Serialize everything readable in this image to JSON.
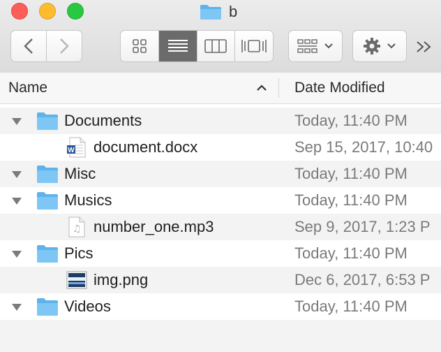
{
  "window": {
    "title": "b",
    "title_icon": "folder-icon"
  },
  "toolbar": {
    "back_icon": "chevron-left-icon",
    "forward_icon": "chevron-right-icon",
    "views": [
      {
        "name": "icon-view-icon",
        "active": false
      },
      {
        "name": "list-view-icon",
        "active": true
      },
      {
        "name": "column-view-icon",
        "active": false
      },
      {
        "name": "cover-flow-view-icon",
        "active": false
      }
    ],
    "arrange_icon": "arrange-grid-icon",
    "action_icon": "gear-icon",
    "more_icon": "double-chevron-right-icon"
  },
  "columns": {
    "name": "Name",
    "date_modified": "Date Modified"
  },
  "rows": [
    {
      "type": "folder",
      "name": "Documents",
      "date": "Today, 11:40 PM",
      "icon": "folder-icon",
      "expanded": true
    },
    {
      "type": "file",
      "name": "document.docx",
      "date": "Sep 15, 2017, 10:40",
      "icon": "word-document-icon"
    },
    {
      "type": "folder",
      "name": "Misc",
      "date": "Today, 11:40 PM",
      "icon": "folder-icon",
      "expanded": true
    },
    {
      "type": "folder",
      "name": "Musics",
      "date": "Today, 11:40 PM",
      "icon": "folder-icon",
      "expanded": true
    },
    {
      "type": "file",
      "name": "number_one.mp3",
      "date": "Sep 9, 2017, 1:23 P",
      "icon": "audio-file-icon"
    },
    {
      "type": "folder",
      "name": "Pics",
      "date": "Today, 11:40 PM",
      "icon": "folder-icon",
      "expanded": true
    },
    {
      "type": "file",
      "name": "img.png",
      "date": "Dec 6, 2017, 6:53 P",
      "icon": "image-file-icon"
    },
    {
      "type": "folder",
      "name": "Videos",
      "date": "Today, 11:40 PM",
      "icon": "folder-icon",
      "expanded": true
    }
  ],
  "colors": {
    "folder_blue": "#6cbdf0",
    "row_alt": "#f3f3f3",
    "date_text": "#7a7a7a"
  }
}
